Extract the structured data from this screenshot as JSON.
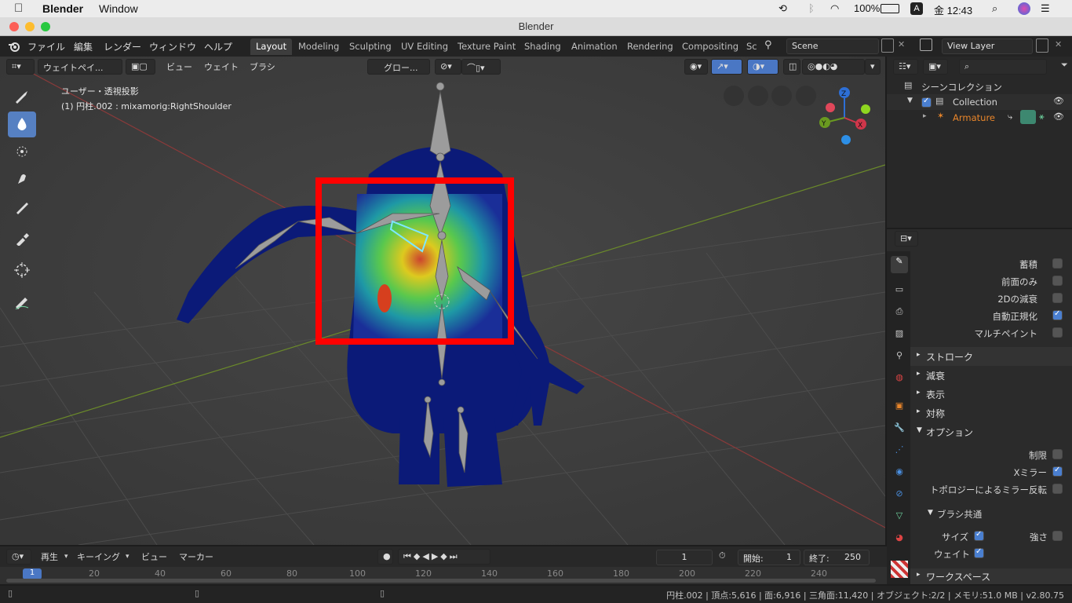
{
  "macbar": {
    "app_name": "Blender",
    "menu": [
      "Window"
    ],
    "clock": "金 12:43",
    "battery": "100%",
    "input_badge": "A"
  },
  "window": {
    "title": "Blender"
  },
  "topbar": {
    "menus": [
      "ファイル",
      "編集",
      "レンダー",
      "ウィンドウ",
      "ヘルプ"
    ],
    "workspaces": [
      "Layout",
      "Modeling",
      "Sculpting",
      "UV Editing",
      "Texture Paint",
      "Shading",
      "Animation",
      "Rendering",
      "Compositing",
      "Sc"
    ],
    "active_workspace": "Layout",
    "scene": "Scene",
    "view_layer": "View Layer"
  },
  "viewport": {
    "mode": "ウェイトペイ...",
    "menus": [
      "ビュー",
      "ウェイト",
      "ブラシ"
    ],
    "transform_orientation": "グロー...",
    "info_line1": "ユーザー・透視投影",
    "info_line2": "(1) 円柱.002 : mixamorig:RightShoulder",
    "gizmo_axes": [
      "Z",
      "Y",
      "X"
    ],
    "tools": [
      "draw-brush-icon",
      "blur-drop-icon",
      "average-icon",
      "smear-icon",
      "gradient-icon",
      "sample-weight-icon",
      "cursor-icon",
      "annotate-icon"
    ],
    "highlight_color": "#ff0000"
  },
  "outliner": {
    "root": "シーンコレクション",
    "collection": "Collection",
    "object": "Armature"
  },
  "properties": {
    "top_checks": [
      {
        "label": "蓄積",
        "checked": false
      },
      {
        "label": "前面のみ",
        "checked": false
      },
      {
        "label": "2Dの減衰",
        "checked": false
      },
      {
        "label": "自動正規化",
        "checked": true
      },
      {
        "label": "マルチペイント",
        "checked": false
      }
    ],
    "sections": [
      "ストローク",
      "減衰",
      "表示",
      "対称"
    ],
    "options_section": "オプション",
    "option_checks": [
      {
        "label": "制限",
        "checked": false
      },
      {
        "label": "Xミラー",
        "checked": true
      },
      {
        "label": "トポロジーによるミラー反転",
        "checked": false
      }
    ],
    "brush_common": "ブラシ共通",
    "size_label": "サイズ",
    "strength_label": "強さ",
    "weight_label": "ウェイト",
    "workspace_section": "ワークスペース"
  },
  "timeline": {
    "menus": [
      "再生",
      "キーイング",
      "ビュー",
      "マーカー"
    ],
    "current_frame": "1",
    "start_label": "開始:",
    "start_value": "1",
    "end_label": "終了:",
    "end_value": "250",
    "ruler_ticks": [
      "1",
      "20",
      "40",
      "60",
      "80",
      "100",
      "120",
      "140",
      "160",
      "180",
      "200",
      "220",
      "240"
    ]
  },
  "status": {
    "stats": "円柱.002 | 頂点:5,616 | 面:6,916 | 三角面:11,420 | オブジェクト:2/2 | メモリ:51.0 MB | v2.80.75"
  }
}
